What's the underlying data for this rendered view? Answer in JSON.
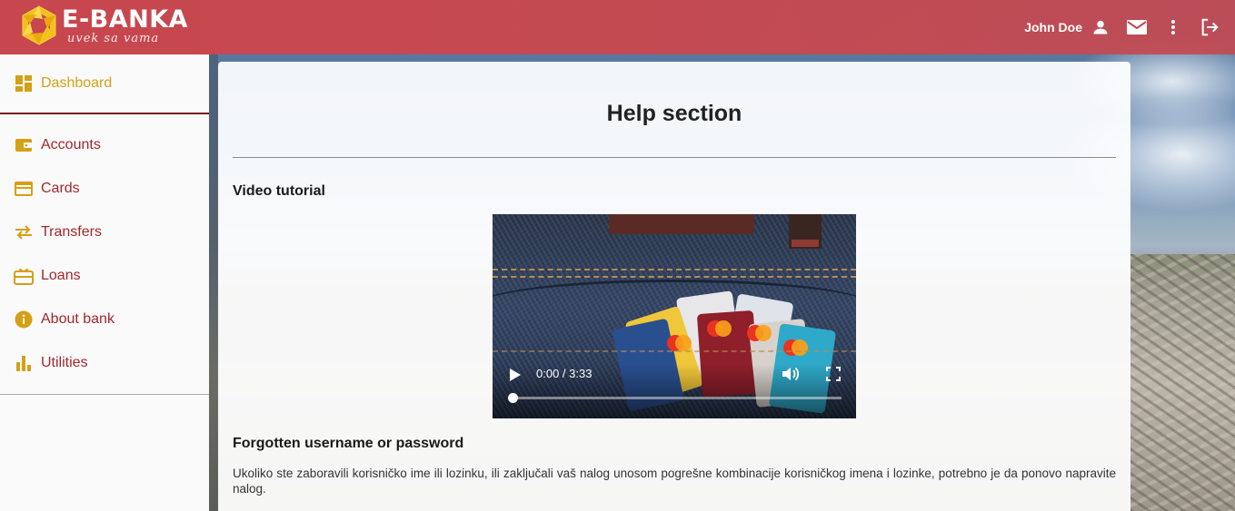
{
  "header": {
    "brand": "E-BANKA",
    "tagline": "uvek sa vama",
    "user_name": "John Doe",
    "icons": [
      "person-icon",
      "mail-icon",
      "more-vert-icon",
      "logout-icon"
    ]
  },
  "sidebar": {
    "items": [
      {
        "label": "Dashboard",
        "icon": "dashboard-icon",
        "active": true
      },
      {
        "label": "Accounts",
        "icon": "wallet-icon"
      },
      {
        "label": "Cards",
        "icon": "credit-card-icon"
      },
      {
        "label": "Transfers",
        "icon": "swap-arrows-icon"
      },
      {
        "label": "Loans",
        "icon": "gift-card-icon"
      },
      {
        "label": "About bank",
        "icon": "info-icon"
      },
      {
        "label": "Utilities",
        "icon": "bar-chart-icon"
      }
    ]
  },
  "main": {
    "title": "Help section",
    "video_section": {
      "heading": "Video tutorial",
      "time": "0:00 / 3:33"
    },
    "forgot_section": {
      "heading": "Forgotten username or password",
      "text": "Ukoliko ste zaboravili korisničko ime ili lozinku, ili zaključali vaš nalog unosom pogrešne kombinacije korisničkog imena i lozinke, potrebno je da ponovo napravite nalog."
    }
  },
  "colors": {
    "header_red": "#c8464e",
    "accent_gold": "#d4a017",
    "nav_red": "#a0282e"
  }
}
